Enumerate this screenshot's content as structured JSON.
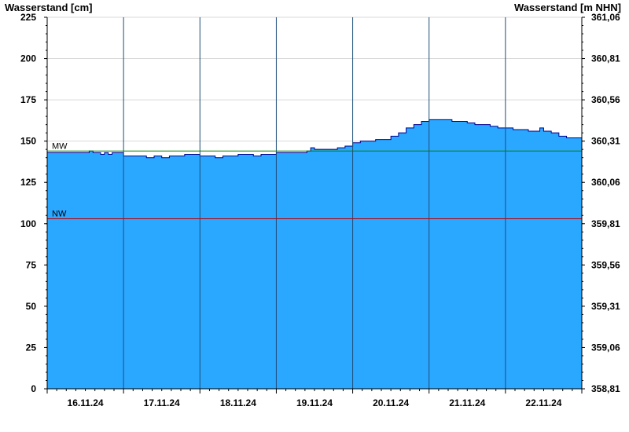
{
  "chart_data": {
    "type": "area",
    "ylabel_left": "Wasserstand [cm]",
    "ylabel_right": "Wasserstand [m NHN]",
    "ylim": [
      0,
      225
    ],
    "yticks_left": [
      "0",
      "25",
      "50",
      "75",
      "100",
      "125",
      "150",
      "175",
      "200",
      "225"
    ],
    "yticks_right": [
      "358,81",
      "359,06",
      "359,31",
      "359,56",
      "359,81",
      "360,06",
      "360,31",
      "360,56",
      "360,81",
      "361,06"
    ],
    "x_categories": [
      "16.11.24",
      "17.11.24",
      "18.11.24",
      "19.11.24",
      "20.11.24",
      "21.11.24",
      "22.11.24"
    ],
    "x_range_days": [
      0,
      7
    ],
    "fill_color": "#2aa7ff",
    "line_color": "#00008b",
    "reference_lines": [
      {
        "label": "MW",
        "value": 144,
        "color": "#008000"
      },
      {
        "label": "NW",
        "value": 103,
        "color": "#c00000"
      }
    ],
    "series": [
      {
        "x": [
          0,
          0.2,
          0.45,
          0.55,
          0.6,
          0.65,
          0.7,
          0.75,
          0.8,
          0.85,
          0.9,
          1.0,
          1.1,
          1.2,
          1.3,
          1.4,
          1.5,
          1.6,
          1.7,
          1.8,
          1.9,
          2.0,
          2.1,
          2.2,
          2.3,
          2.4,
          2.5,
          2.6,
          2.7,
          2.8,
          2.9,
          3.0,
          3.1,
          3.3,
          3.4,
          3.45,
          3.5,
          3.6,
          3.7,
          3.8,
          3.9,
          4.0,
          4.1,
          4.2,
          4.3,
          4.4,
          4.5,
          4.6,
          4.7,
          4.8,
          4.9,
          5.0,
          5.1,
          5.2,
          5.3,
          5.4,
          5.5,
          5.6,
          5.7,
          5.8,
          5.9,
          6.0,
          6.1,
          6.2,
          6.3,
          6.4,
          6.45,
          6.5,
          6.6,
          6.7,
          6.8,
          6.9,
          7.0
        ],
        "y": [
          143,
          143,
          143,
          144,
          143,
          143,
          142,
          143,
          142,
          143,
          143,
          141,
          141,
          141,
          140,
          141,
          140,
          141,
          141,
          142,
          142,
          141,
          141,
          140,
          141,
          141,
          142,
          142,
          141,
          142,
          142,
          143,
          143,
          143,
          144,
          146,
          145,
          145,
          145,
          146,
          147,
          149,
          150,
          150,
          151,
          151,
          153,
          155,
          158,
          160,
          162,
          163,
          163,
          163,
          162,
          162,
          161,
          160,
          160,
          159,
          158,
          158,
          157,
          157,
          156,
          156,
          158,
          156,
          155,
          153,
          152,
          152,
          152
        ]
      }
    ],
    "grid": true
  }
}
